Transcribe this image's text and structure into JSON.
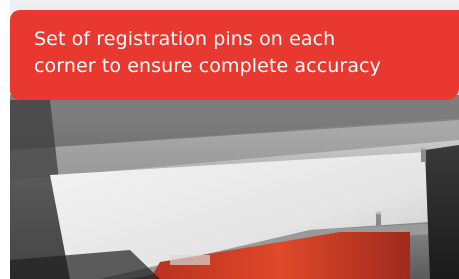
{
  "caption": {
    "text": "Set of registration pins on each\ncorner to ensure complete accuracy",
    "background_color": "#e8382f",
    "text_color": "#ffffff"
  },
  "photo": {
    "subject": "registration pins on corner of press frame"
  }
}
